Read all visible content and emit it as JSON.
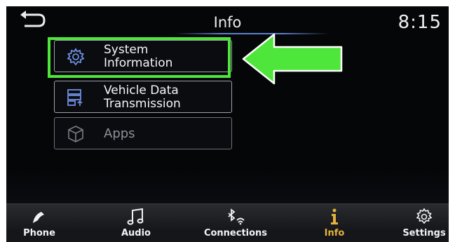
{
  "header": {
    "title": "Info",
    "time": "8:15",
    "back_icon": "back-arrow-icon"
  },
  "menu": {
    "items": [
      {
        "label": "System\nInformation",
        "icon": "gear-icon",
        "enabled": true,
        "highlighted": true
      },
      {
        "label": "Vehicle Data\nTransmission",
        "icon": "data-transmission-icon",
        "enabled": true
      },
      {
        "label": "Apps",
        "icon": "cube-icon",
        "enabled": false
      }
    ]
  },
  "annotation": {
    "highlight_color": "#4ee63a",
    "arrow_color": "#4ee63a"
  },
  "bottom_bar": {
    "tabs": [
      {
        "label": "Phone",
        "icon": "phone-icon"
      },
      {
        "label": "Audio",
        "icon": "music-note-icon"
      },
      {
        "label": "Connections",
        "icon": "bluetooth-wifi-icon"
      },
      {
        "label": "Info",
        "icon": "info-icon",
        "active": true,
        "active_color": "#e3b23c"
      },
      {
        "label": "Settings",
        "icon": "gear-icon"
      }
    ]
  }
}
